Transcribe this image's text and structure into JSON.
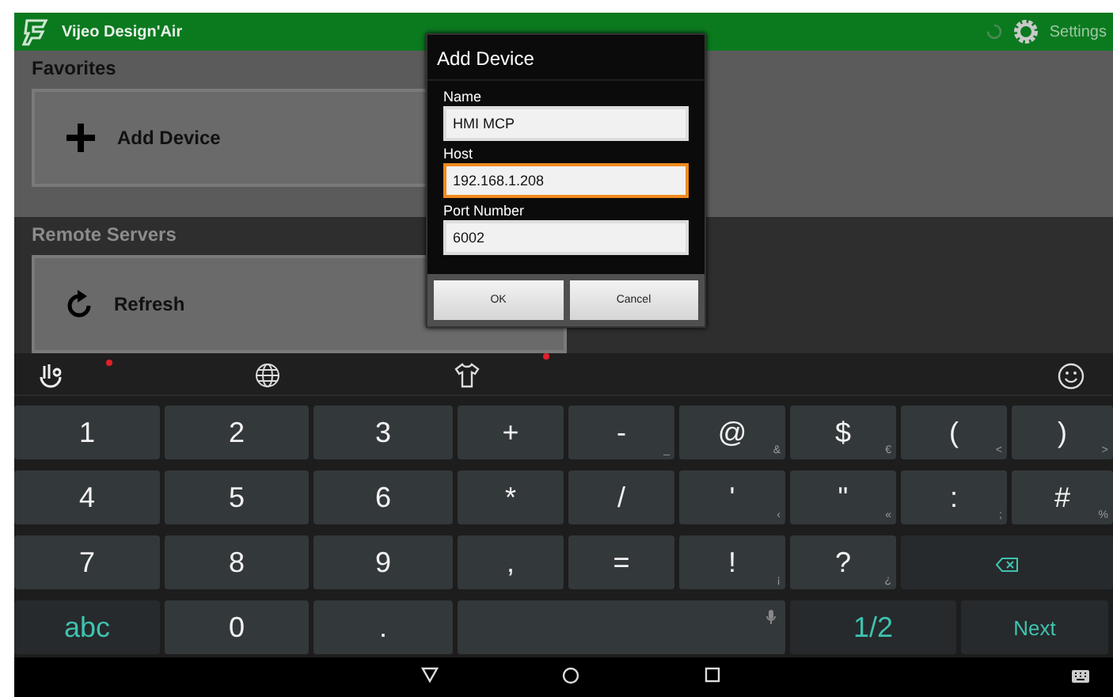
{
  "header": {
    "app_name": "Vijeo Design'Air",
    "settings_label": "Settings"
  },
  "sections": [
    {
      "title": "Favorites",
      "kind": "light",
      "card": {
        "label": "Add Device"
      }
    },
    {
      "title": "Remote Servers",
      "kind": "dark",
      "card": {
        "label": "Refresh"
      }
    }
  ],
  "dialog": {
    "title": "Add Device",
    "fields": [
      {
        "label": "Name",
        "value": "HMI MCP",
        "focused": false
      },
      {
        "label": "Host",
        "value": "192.168.1.208",
        "focused": true
      },
      {
        "label": "Port Number",
        "value": "6002",
        "focused": false
      }
    ],
    "buttons": [
      "OK",
      "Cancel"
    ]
  },
  "keyboard": {
    "rows": [
      [
        {
          "kind": "key",
          "label": "1"
        },
        {
          "kind": "key",
          "label": "2"
        },
        {
          "kind": "key",
          "label": "3"
        },
        {
          "kind": "key",
          "label": "+"
        },
        {
          "kind": "key",
          "label": "-",
          "hint": "_"
        },
        {
          "kind": "key",
          "label": "@",
          "hint": "&"
        },
        {
          "kind": "key",
          "label": "$",
          "hint": "€"
        },
        {
          "kind": "key",
          "label": "(",
          "hint": "<"
        },
        {
          "kind": "key",
          "label": ")",
          "hint": ">"
        }
      ],
      [
        {
          "kind": "key",
          "label": "4"
        },
        {
          "kind": "key",
          "label": "5"
        },
        {
          "kind": "key",
          "label": "6"
        },
        {
          "kind": "key",
          "label": "*"
        },
        {
          "kind": "key",
          "label": "/"
        },
        {
          "kind": "key",
          "label": "'",
          "hint": "‹"
        },
        {
          "kind": "key",
          "label": "\"",
          "hint": "«"
        },
        {
          "kind": "key",
          "label": ":",
          "hint": ";"
        },
        {
          "kind": "key",
          "label": "#",
          "hint": "%"
        }
      ],
      [
        {
          "kind": "key",
          "label": "7"
        },
        {
          "kind": "key",
          "label": "8"
        },
        {
          "kind": "key",
          "label": "9"
        },
        {
          "kind": "key",
          "label": ","
        },
        {
          "kind": "key",
          "label": "="
        },
        {
          "kind": "key",
          "label": "!",
          "hint": "¡"
        },
        {
          "kind": "key",
          "label": "?",
          "hint": "¿"
        },
        {
          "kind": "backspace"
        }
      ]
    ],
    "bottom_row": [
      {
        "kind": "action",
        "label": "abc"
      },
      {
        "kind": "key",
        "label": "0"
      },
      {
        "kind": "key",
        "label": "."
      },
      {
        "kind": "space"
      },
      {
        "kind": "action",
        "label": "1/2"
      },
      {
        "kind": "text_action",
        "label": "Next"
      }
    ]
  }
}
